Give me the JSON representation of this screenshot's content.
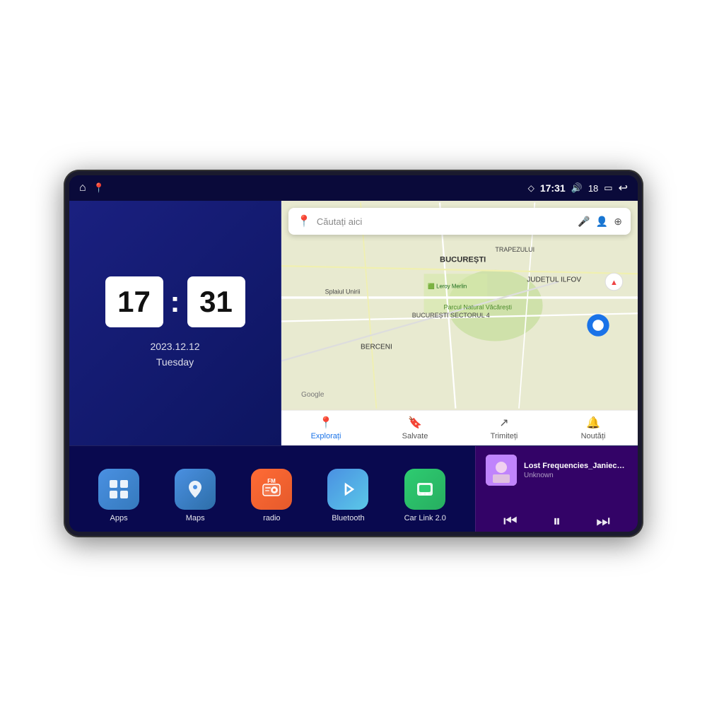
{
  "device": {
    "status_bar": {
      "home_icon": "⌂",
      "maps_icon": "📍",
      "signal_icon": "◇",
      "time": "17:31",
      "volume_icon": "🔊",
      "volume_level": "18",
      "battery_icon": "🔋",
      "back_icon": "↩"
    },
    "clock": {
      "hour": "17",
      "minute": "31",
      "date": "2023.12.12",
      "day": "Tuesday"
    },
    "map": {
      "search_placeholder": "Căutați aici",
      "nav_items": [
        {
          "label": "Explorați",
          "icon": "📍",
          "active": true
        },
        {
          "label": "Salvate",
          "icon": "🔖",
          "active": false
        },
        {
          "label": "Trimiteți",
          "icon": "↗",
          "active": false
        },
        {
          "label": "Noutăți",
          "icon": "🔔",
          "active": false
        }
      ]
    },
    "apps": [
      {
        "id": "apps",
        "label": "Apps",
        "icon": "⊞",
        "class": "app-icon-apps"
      },
      {
        "id": "maps",
        "label": "Maps",
        "icon": "🗺",
        "class": "app-icon-maps"
      },
      {
        "id": "radio",
        "label": "radio",
        "icon": "📻",
        "class": "app-icon-radio"
      },
      {
        "id": "bluetooth",
        "label": "Bluetooth",
        "icon": "⬡",
        "class": "app-icon-bluetooth"
      },
      {
        "id": "carlink",
        "label": "Car Link 2.0",
        "icon": "📱",
        "class": "app-icon-carlink"
      }
    ],
    "music": {
      "title": "Lost Frequencies_Janieck Devy-...",
      "artist": "Unknown",
      "prev_icon": "⏮",
      "play_icon": "⏸",
      "next_icon": "⏭"
    }
  }
}
